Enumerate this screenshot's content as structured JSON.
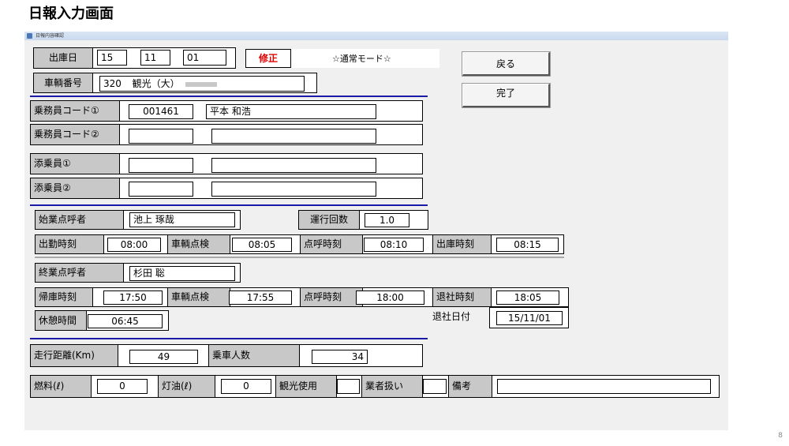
{
  "page_title": "日報入力画面",
  "window_title": "日報内容確認",
  "page_number": "8",
  "header": {
    "shukko_bi_label": "出庫日",
    "date_year": "15",
    "date_month": "11",
    "date_day": "01",
    "mode_edit": "修正",
    "mode_normal": "☆通常モード☆",
    "vehicle_label": "車輌番号",
    "vehicle_number": "320",
    "vehicle_name": "観光（大）"
  },
  "buttons": {
    "back": "戻る",
    "done": "完了"
  },
  "crew": [
    {
      "label": "乗務員コード①",
      "code": "001461",
      "name": "平本 和浩"
    },
    {
      "label": "乗務員コード②",
      "code": "",
      "name": ""
    },
    {
      "label": "添乗員①",
      "code": "",
      "name": ""
    },
    {
      "label": "添乗員②",
      "code": "",
      "name": ""
    }
  ],
  "roll_call_start": {
    "label": "始業点呼者",
    "name": "池上 琢哉",
    "operation_count_label": "運行回数",
    "operation_count": "1.0",
    "attend_time_label": "出勤時刻",
    "attend_time": "08:00",
    "vehicle_check_label": "車輌点検",
    "vehicle_check": "08:05",
    "roll_call_time_label": "点呼時刻",
    "roll_call_time": "08:10",
    "depart_time_label": "出庫時刻",
    "depart_time": "08:15"
  },
  "roll_call_end": {
    "label": "終業点呼者",
    "name": "杉田 聡",
    "return_time_label": "帰庫時刻",
    "return_time": "17:50",
    "vehicle_check_label": "車輌点検",
    "vehicle_check": "17:55",
    "roll_call_time_label": "点呼時刻",
    "roll_call_time": "18:00",
    "leave_time_label": "退社時刻",
    "leave_time": "18:05",
    "break_label": "休憩時間",
    "break_time": "06:45",
    "leave_date_label": "退社日付",
    "leave_date": "15/11/01"
  },
  "travel": {
    "distance_label": "走行距離(Km)",
    "distance": "49",
    "passengers_label": "乗車人数",
    "passengers": "34"
  },
  "fuel": {
    "fuel_label": "燃料(ℓ)",
    "fuel": "0",
    "kerosene_label": "灯油(ℓ)",
    "kerosene": "0",
    "sightseeing_label": "観光使用",
    "sightseeing": "",
    "vendor_label": "業者扱い",
    "vendor": "",
    "remarks_label": "備考",
    "remarks": ""
  }
}
